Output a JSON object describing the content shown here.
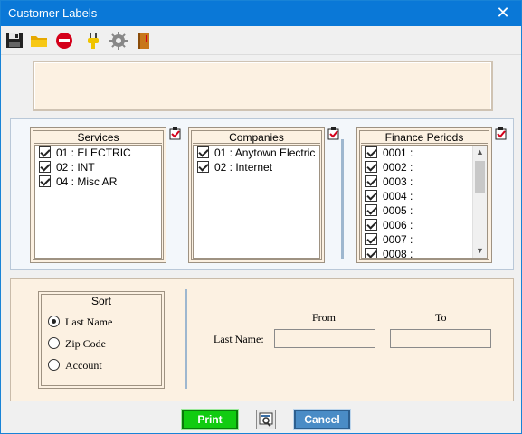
{
  "window": {
    "title": "Customer Labels",
    "close_glyph": "✕"
  },
  "toolbar": [
    {
      "name": "save-icon",
      "color": "#222222"
    },
    {
      "name": "open-folder-icon",
      "color": "#f4c000"
    },
    {
      "name": "stop-icon",
      "color": "#d4001a"
    },
    {
      "name": "plug-icon",
      "color": "#f0c400"
    },
    {
      "name": "gear-icon",
      "color": "#808080"
    },
    {
      "name": "book-icon",
      "color": "#c8771a"
    }
  ],
  "groups": {
    "services": {
      "title": "Services",
      "items": [
        "01 : ELECTRIC",
        "02 : INT",
        "04 : Misc AR"
      ]
    },
    "companies": {
      "title": "Companies",
      "items": [
        "01 : Anytown Electric",
        "02 : Internet"
      ]
    },
    "finance_periods": {
      "title": "Finance Periods",
      "items": [
        "0001 :",
        "0002 :",
        "0003 :",
        "0004 :",
        "0005 :",
        "0006 :",
        "0007 :",
        "0008 :"
      ]
    }
  },
  "sort": {
    "title": "Sort",
    "options": [
      "Last Name",
      "Zip Code",
      "Account"
    ],
    "selected": "Last Name"
  },
  "range": {
    "from_label": "From",
    "to_label": "To",
    "row_label": "Last Name:",
    "from_value": "",
    "to_value": ""
  },
  "buttons": {
    "print": "Print",
    "cancel": "Cancel"
  }
}
